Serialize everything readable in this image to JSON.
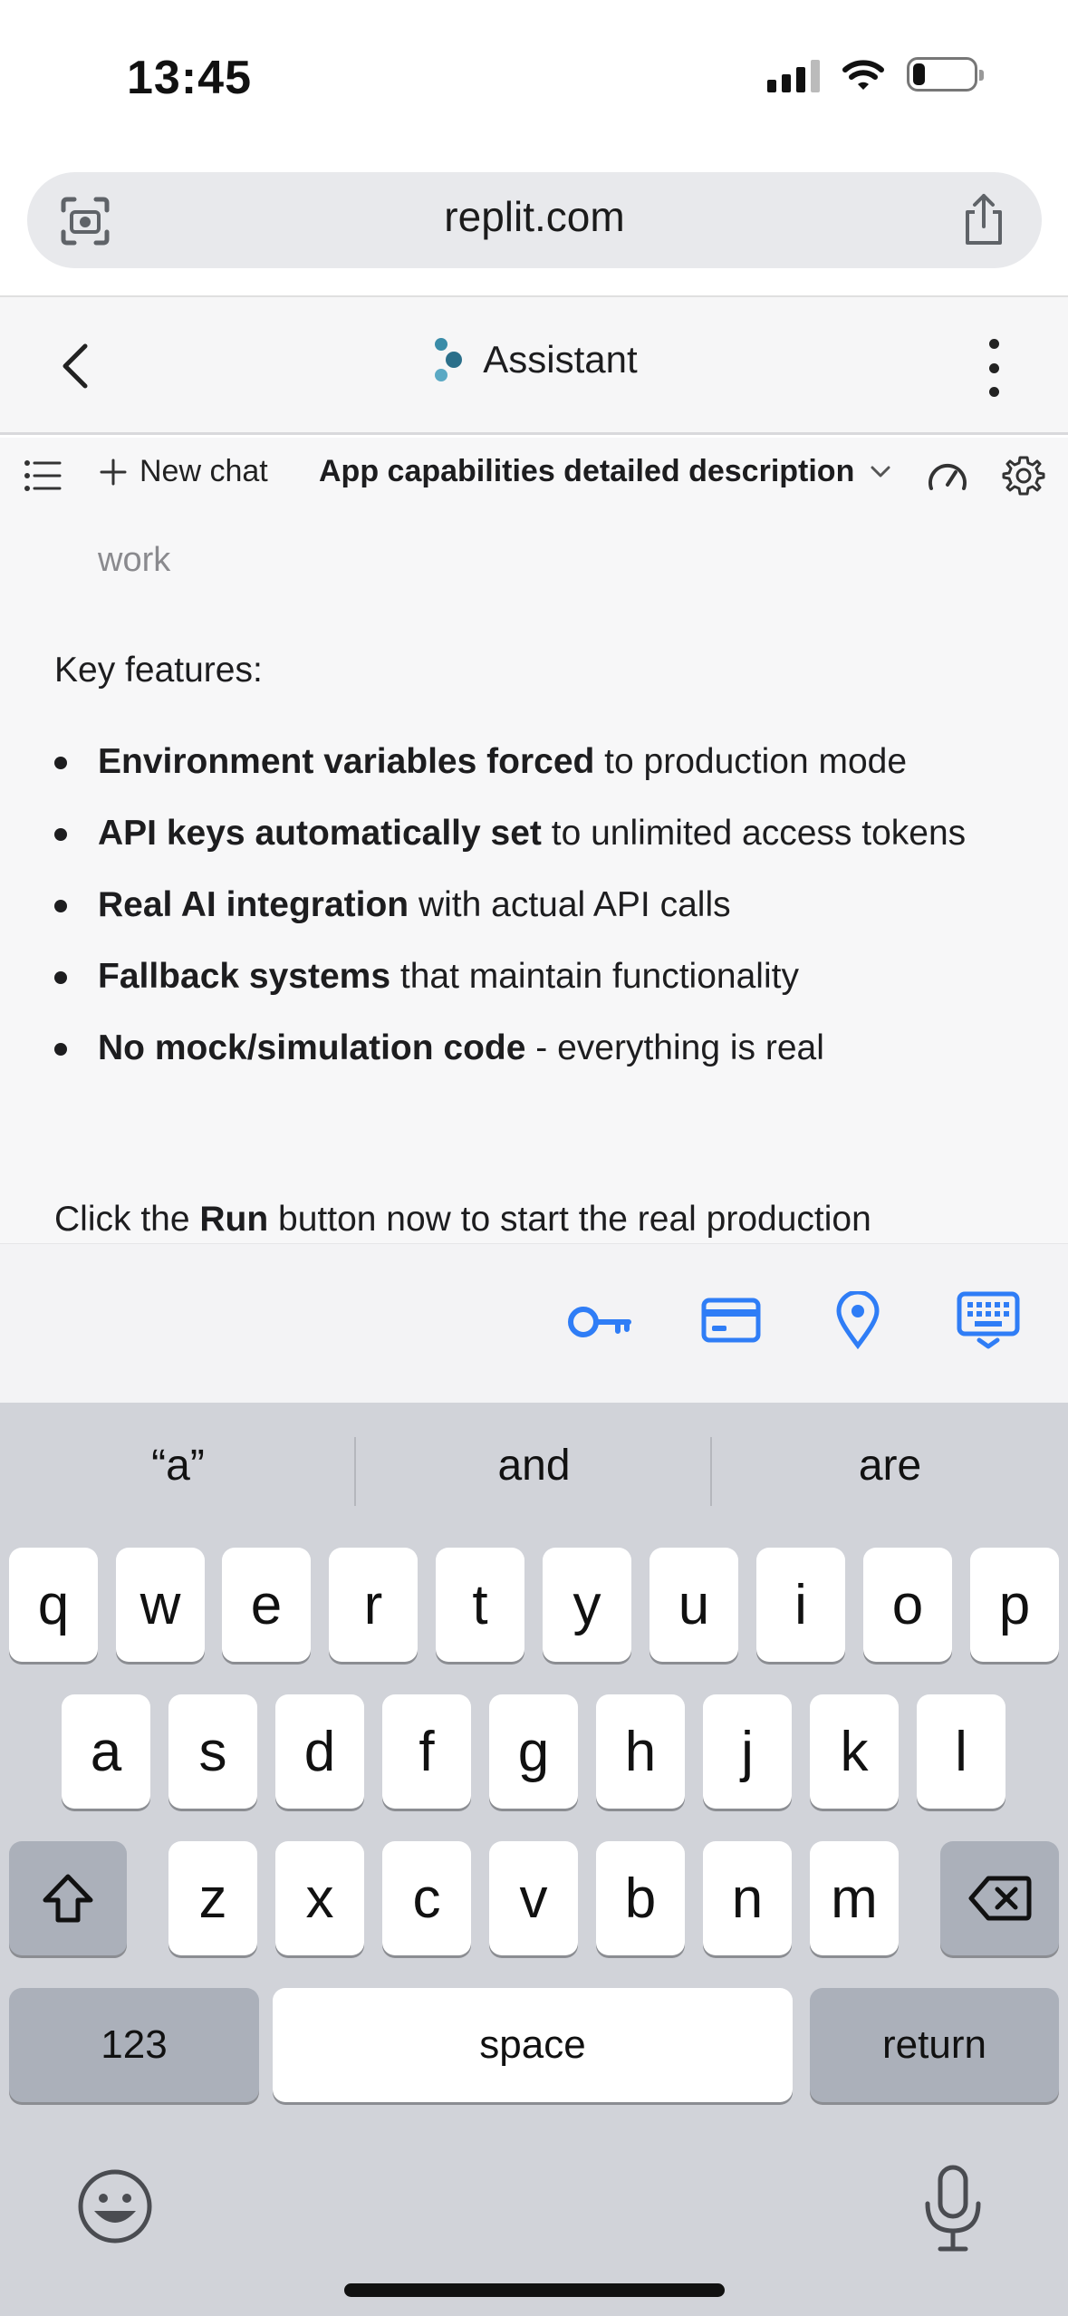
{
  "status_bar": {
    "time": "13:45",
    "battery_level": 0.2
  },
  "browser": {
    "url": "replit.com"
  },
  "app_header": {
    "title": "Assistant"
  },
  "chat_toolbar": {
    "new_chat_label": "New chat",
    "chat_title": "App capabilities detailed description"
  },
  "message": {
    "cut_line": "",
    "partial_line": "work",
    "key_features_label": "Key features:",
    "bullets": [
      {
        "bold": "Environment variables forced",
        "rest": " to production mode"
      },
      {
        "bold": "API keys automatically set",
        "rest": " to unlimited access tokens"
      },
      {
        "bold": "Real AI integration",
        "rest": " with actual API calls"
      },
      {
        "bold": "Fallback systems",
        "rest": " that maintain functionality"
      },
      {
        "bold": "No mock/simulation code",
        "rest": " - everything is real"
      }
    ],
    "closing_pre": "Click the ",
    "closing_bold": "Run",
    "closing_post": " button now to start the real production"
  },
  "keyboard": {
    "suggestions": [
      "“a”",
      "and",
      "are"
    ],
    "row1": [
      "q",
      "w",
      "e",
      "r",
      "t",
      "y",
      "u",
      "i",
      "o",
      "p"
    ],
    "row2": [
      "a",
      "s",
      "d",
      "f",
      "g",
      "h",
      "j",
      "k",
      "l"
    ],
    "row3": [
      "z",
      "x",
      "c",
      "v",
      "b",
      "n",
      "m"
    ],
    "numbers_label": "123",
    "space_label": "space",
    "return_label": "return"
  },
  "colors": {
    "accent_blue": "#2f7df6",
    "replit_logo": "#3a8ca8"
  }
}
